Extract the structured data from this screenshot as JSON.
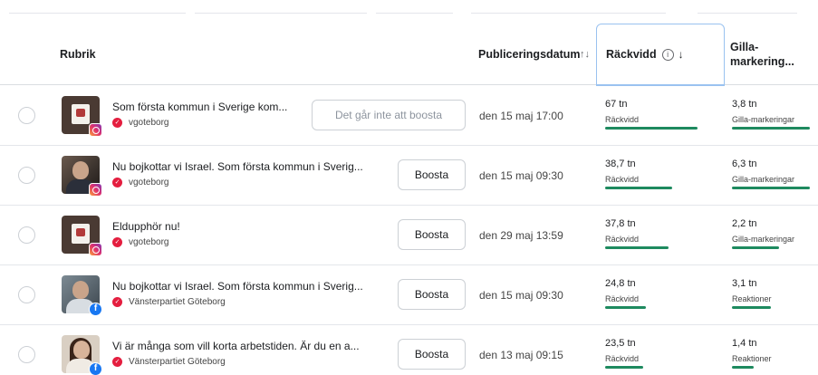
{
  "header": {
    "col_title": "Rubrik",
    "col_date": "Publiceringsdatum",
    "col_reach": "Räckvidd",
    "col_likes": "Gilla-markering..."
  },
  "rows": [
    {
      "title": "Som första kommun i Sverige kom...",
      "account": "vgoteborg",
      "platform": "instagram-icon",
      "button": "Det går inte att boosta",
      "button_disabled": true,
      "date": "den 15 maj 17:00",
      "reach": "67 tn",
      "reach_label": "Räckvidd",
      "reach_fraction": 0.97,
      "likes": "3,8 tn",
      "likes_label": "Gilla-markeringar",
      "likes_fraction": 0.9
    },
    {
      "title": "Nu bojkottar vi Israel. Som första kommun i Sverig...",
      "account": "vgoteborg",
      "platform": "instagram-icon",
      "button": "Boosta",
      "button_disabled": false,
      "date": "den 15 maj 09:30",
      "reach": "38,7 tn",
      "reach_label": "Räckvidd",
      "reach_fraction": 0.7,
      "likes": "6,3 tn",
      "likes_label": "Gilla-markeringar",
      "likes_fraction": 0.9
    },
    {
      "title": "Eldupphör nu!",
      "account": "vgoteborg",
      "platform": "instagram-icon",
      "button": "Boosta",
      "button_disabled": false,
      "date": "den 29 maj 13:59",
      "reach": "37,8 tn",
      "reach_label": "Räckvidd",
      "reach_fraction": 0.67,
      "likes": "2,2 tn",
      "likes_label": "Gilla-markeringar",
      "likes_fraction": 0.55
    },
    {
      "title": "Nu bojkottar vi Israel. Som första kommun i Sverig...",
      "account": "Vänsterpartiet Göteborg",
      "platform": "facebook-icon",
      "button": "Boosta",
      "button_disabled": false,
      "date": "den 15 maj 09:30",
      "reach": "24,8 tn",
      "reach_label": "Räckvidd",
      "reach_fraction": 0.43,
      "likes": "3,1 tn",
      "likes_label": "Reaktioner",
      "likes_fraction": 0.45
    },
    {
      "title": "Vi är många som vill korta arbetstiden. Är du en a...",
      "account": "Vänsterpartiet Göteborg",
      "platform": "facebook-icon",
      "button": "Boosta",
      "button_disabled": false,
      "date": "den 13 maj 09:15",
      "reach": "23,5 tn",
      "reach_label": "Räckvidd",
      "reach_fraction": 0.4,
      "likes": "1,4 tn",
      "likes_label": "Reaktioner",
      "likes_fraction": 0.25
    }
  ]
}
